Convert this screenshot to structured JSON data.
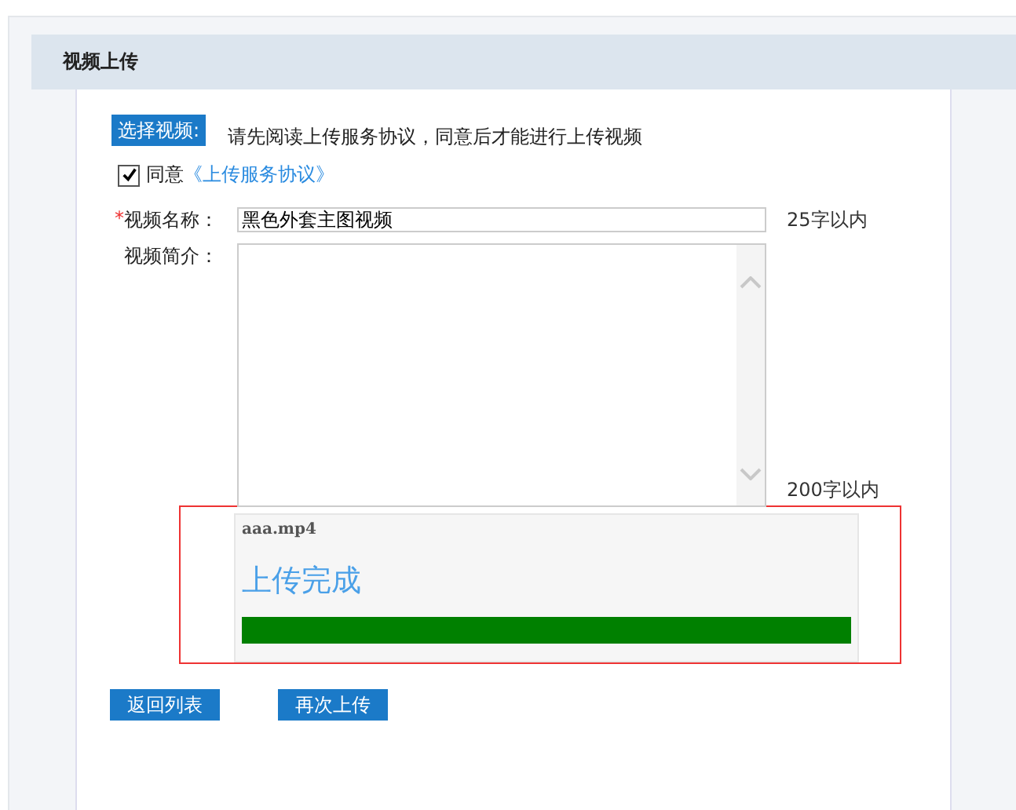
{
  "header": {
    "title": "视频上传"
  },
  "choose_button": "选择视频:",
  "notice": "请先阅读上传服务协议，同意后才能进行上传视频",
  "agree": {
    "checked": true,
    "label": "同意",
    "link": "《上传服务协议》"
  },
  "fields": [
    {
      "kind": "text",
      "required_mark": "*",
      "label": "视频名称：",
      "value": "黑色外套主图视频",
      "hint": "25字以内"
    },
    {
      "kind": "textarea",
      "label": "视频简介：",
      "hint": "200字以内"
    }
  ],
  "upload": {
    "filename": "aaa.mp4",
    "status": "上传完成",
    "level": 1
  },
  "buttons": [
    "返回列表",
    "再次上传"
  ]
}
